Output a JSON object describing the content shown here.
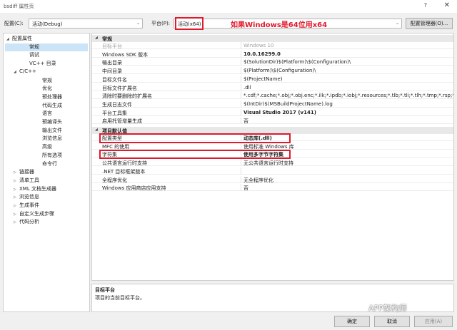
{
  "window": {
    "title": "bsdiff 属性页",
    "help_label": "?",
    "close_label": "✕"
  },
  "config_bar": {
    "config_label": "配置(C):",
    "config_value": "活动(Debug)",
    "platform_label": "平台(P):",
    "platform_value": "活动(x64)",
    "annotation": "如果Windows是64位用x64",
    "config_manager_label": "配置管理器(O)..."
  },
  "tree": [
    {
      "label": "配置属性",
      "level": 0,
      "expander": "◢",
      "selected": false
    },
    {
      "label": "常规",
      "level": 2,
      "expander": "",
      "selected": true
    },
    {
      "label": "调试",
      "level": 2,
      "expander": "",
      "selected": false
    },
    {
      "label": "VC++ 目录",
      "level": 2,
      "expander": "",
      "selected": false
    },
    {
      "label": "C/C++",
      "level": 1,
      "expander": "◢",
      "selected": false
    },
    {
      "label": "常规",
      "level": 3,
      "expander": "",
      "selected": false
    },
    {
      "label": "优化",
      "level": 3,
      "expander": "",
      "selected": false
    },
    {
      "label": "预处理器",
      "level": 3,
      "expander": "",
      "selected": false
    },
    {
      "label": "代码生成",
      "level": 3,
      "expander": "",
      "selected": false
    },
    {
      "label": "语言",
      "level": 3,
      "expander": "",
      "selected": false
    },
    {
      "label": "预编译头",
      "level": 3,
      "expander": "",
      "selected": false
    },
    {
      "label": "输出文件",
      "level": 3,
      "expander": "",
      "selected": false
    },
    {
      "label": "浏览信息",
      "level": 3,
      "expander": "",
      "selected": false
    },
    {
      "label": "高级",
      "level": 3,
      "expander": "",
      "selected": false
    },
    {
      "label": "所有选项",
      "level": 3,
      "expander": "",
      "selected": false
    },
    {
      "label": "命令行",
      "level": 3,
      "expander": "",
      "selected": false
    },
    {
      "label": "链接器",
      "level": 1,
      "expander": "▷",
      "selected": false
    },
    {
      "label": "清单工具",
      "level": 1,
      "expander": "▷",
      "selected": false
    },
    {
      "label": "XML 文档生成器",
      "level": 1,
      "expander": "▷",
      "selected": false
    },
    {
      "label": "浏览信息",
      "level": 1,
      "expander": "▷",
      "selected": false
    },
    {
      "label": "生成事件",
      "level": 1,
      "expander": "▷",
      "selected": false
    },
    {
      "label": "自定义生成步骤",
      "level": 1,
      "expander": "▷",
      "selected": false
    },
    {
      "label": "代码分析",
      "level": 1,
      "expander": "▷",
      "selected": false
    }
  ],
  "grid": {
    "categories": [
      {
        "label": "常规",
        "expander": "◢"
      },
      {
        "label": "项目默认值",
        "expander": "◢"
      }
    ],
    "general_rows": [
      {
        "name": "目标平台",
        "value": "Windows 10",
        "dim": true,
        "bold": false
      },
      {
        "name": "Windows SDK 版本",
        "value": "10.0.16299.0",
        "dim": false,
        "bold": true
      },
      {
        "name": "输出目录",
        "value": "$(SolutionDir)$(Platform)\\$(Configuration)\\",
        "dim": false,
        "bold": false
      },
      {
        "name": "中间目录",
        "value": "$(Platform)\\$(Configuration)\\",
        "dim": false,
        "bold": false
      },
      {
        "name": "目标文件名",
        "value": "$(ProjectName)",
        "dim": false,
        "bold": false
      },
      {
        "name": "目标文件扩展名",
        "value": ".dll",
        "dim": false,
        "bold": false
      },
      {
        "name": "清除时要删除的扩展名",
        "value": "*.cdf;*.cache;*.obj;*.obj.enc;*.ilk;*.ipdb;*.iobj;*.resources;*.tlb;*.tli;*.tlh;*.tmp;*.rsp;*.pgc",
        "dim": false,
        "bold": false
      },
      {
        "name": "生成日志文件",
        "value": "$(IntDir)$(MSBuildProjectName).log",
        "dim": false,
        "bold": false
      },
      {
        "name": "平台工具集",
        "value": "Visual Studio 2017 (v141)",
        "dim": false,
        "bold": true
      },
      {
        "name": "启用托管增量生成",
        "value": "否",
        "dim": false,
        "bold": false
      }
    ],
    "default_rows": [
      {
        "name": "配置类型",
        "value": "动态库(.dll)",
        "dim": false,
        "bold": true
      },
      {
        "name": "MFC 的使用",
        "value": "使用标准 Windows 库",
        "dim": false,
        "bold": false
      },
      {
        "name": "字符集",
        "value": "使用多字节字符集",
        "dim": false,
        "bold": true
      },
      {
        "name": "公共语言运行时支持",
        "value": "无公共语言运行时支持",
        "dim": false,
        "bold": false
      },
      {
        "name": ".NET 目标框架版本",
        "value": "",
        "dim": false,
        "bold": false
      },
      {
        "name": "全程序优化",
        "value": "无全程序优化",
        "dim": false,
        "bold": false
      },
      {
        "name": "Windows 应用商店应用支持",
        "value": "否",
        "dim": false,
        "bold": false
      }
    ]
  },
  "description": {
    "title": "目标平台",
    "text": "项目的当前目标平台。"
  },
  "buttons": {
    "ok": "确定",
    "cancel": "取消",
    "apply": "应用(A)"
  },
  "watermark": {
    "text": "APP架构师"
  },
  "colors": {
    "highlight_red": "#e0192c",
    "tree_selection": "#cce4f7"
  }
}
